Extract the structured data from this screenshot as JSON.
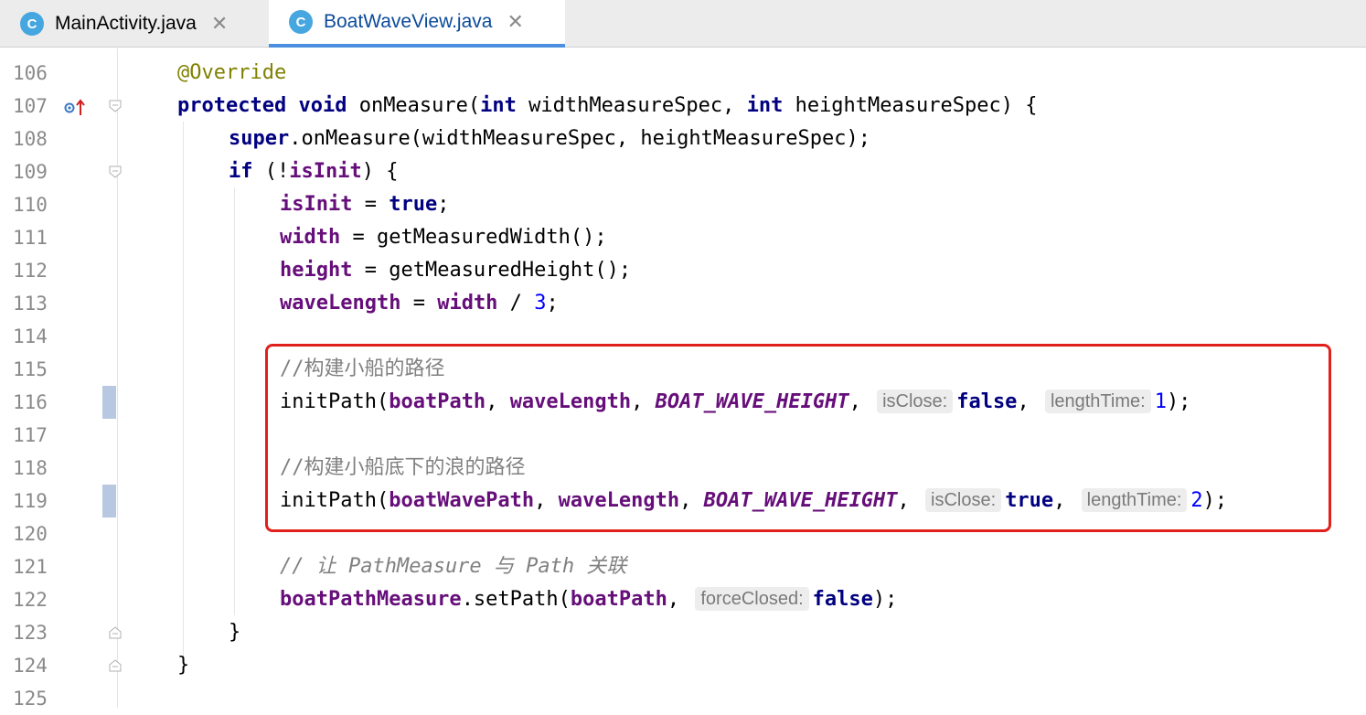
{
  "tabs": [
    {
      "icon": "C",
      "label": "MainActivity.java",
      "active": false
    },
    {
      "icon": "C",
      "label": "BoatWaveView.java",
      "active": true
    }
  ],
  "lines": {
    "n106": "106",
    "n107": "107",
    "n108": "108",
    "n109": "109",
    "n110": "110",
    "n111": "111",
    "n112": "112",
    "n113": "113",
    "n114": "114",
    "n115": "115",
    "n116": "116",
    "n117": "117",
    "n118": "118",
    "n119": "119",
    "n120": "120",
    "n121": "121",
    "n122": "122",
    "n123": "123",
    "n124": "124",
    "n125": "125"
  },
  "code": {
    "l106_ann": "@Override",
    "l107_kw1": "protected",
    "l107_kw2": "void",
    "l107_m": " onMeasure(",
    "l107_kw3": "int",
    "l107_p1": " widthMeasureSpec, ",
    "l107_kw4": "int",
    "l107_p2": " heightMeasureSpec) {",
    "l108_kw": "super",
    "l108_rest": ".onMeasure(widthMeasureSpec, heightMeasureSpec);",
    "l109_kw": "if",
    "l109_a": " (!",
    "l109_f": "isInit",
    "l109_b": ") {",
    "l110_f": "isInit",
    "l110_a": " = ",
    "l110_kw": "true",
    "l110_b": ";",
    "l111_f": "width",
    "l111_a": " = getMeasuredWidth();",
    "l112_f": "height",
    "l112_a": " = getMeasuredHeight();",
    "l113_f1": "waveLength",
    "l113_a": " = ",
    "l113_f2": "width",
    "l113_b": " / ",
    "l113_n": "3",
    "l113_c": ";",
    "l115_cmt": "//构建小船的路径",
    "l116_a": "initPath(",
    "l116_f1": "boatPath",
    "l116_b": ", ",
    "l116_f2": "waveLength",
    "l116_c": ", ",
    "l116_const": "BOAT_WAVE_HEIGHT",
    "l116_d": ", ",
    "l116_h1": "isClose:",
    "l116_kw": "false",
    "l116_e": ", ",
    "l116_h2": "lengthTime:",
    "l116_n": "1",
    "l116_f": ");",
    "l118_cmt": "//构建小船底下的浪的路径",
    "l119_a": "initPath(",
    "l119_f1": "boatWavePath",
    "l119_b": ", ",
    "l119_f2": "waveLength",
    "l119_c": ", ",
    "l119_const": "BOAT_WAVE_HEIGHT",
    "l119_d": ", ",
    "l119_h1": "isClose:",
    "l119_kw": "true",
    "l119_e": ", ",
    "l119_h2": "lengthTime:",
    "l119_n": "2",
    "l119_f": ");",
    "l121_cmt": "// 让 PathMeasure 与 Path 关联",
    "l122_f1": "boatPathMeasure",
    "l122_a": ".setPath(",
    "l122_f2": "boatPath",
    "l122_b": ", ",
    "l122_h": "forceClosed:",
    "l122_kw": "false",
    "l122_c": ");",
    "l123": "}",
    "l124": "}"
  },
  "colors": {
    "keyword": "#000080",
    "field": "#660e7a",
    "annotation": "#808000",
    "number": "#0000ff",
    "comment": "#808080",
    "highlight_box": "#e0201a",
    "active_tab_underline": "#4a8fe0"
  },
  "icons": {
    "tab_file": "class-c-icon",
    "tab_close": "close-icon",
    "override": "override-up-arrow-icon",
    "fold": "fold-marker-icon"
  }
}
